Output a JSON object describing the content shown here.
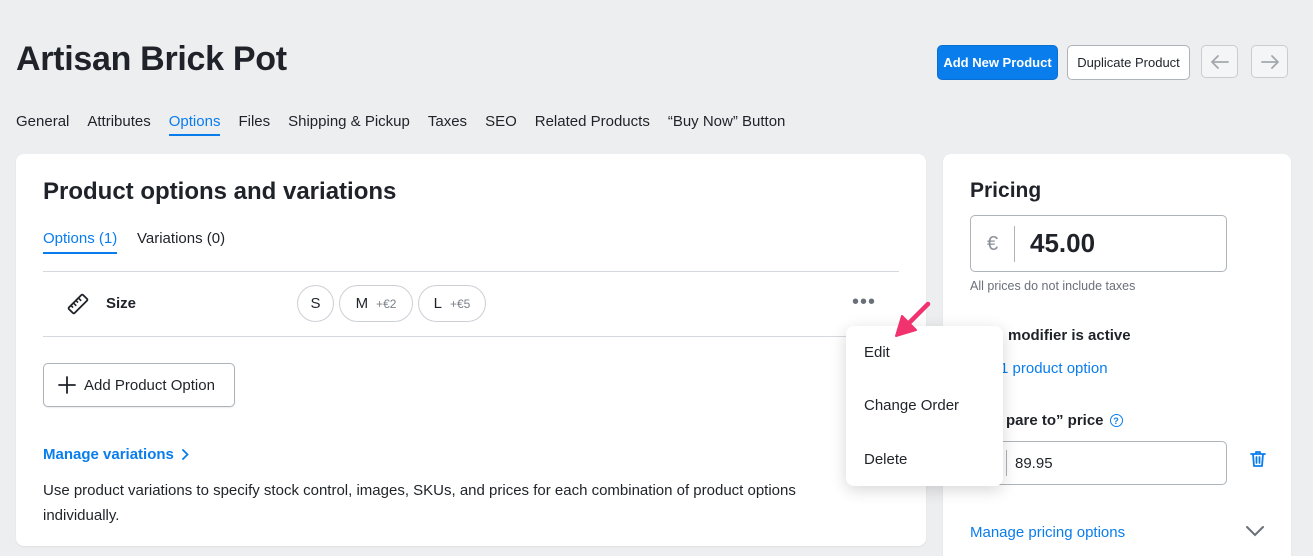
{
  "page": {
    "title": "Artisan Brick Pot"
  },
  "header": {
    "add_new_label": "Add New Product",
    "duplicate_label": "Duplicate Product",
    "prev_icon": "arrow-left-icon",
    "next_icon": "arrow-right-icon"
  },
  "tabs": [
    {
      "label": "General",
      "active": false
    },
    {
      "label": "Attributes",
      "active": false
    },
    {
      "label": "Options",
      "active": true
    },
    {
      "label": "Files",
      "active": false
    },
    {
      "label": "Shipping & Pickup",
      "active": false
    },
    {
      "label": "Taxes",
      "active": false
    },
    {
      "label": "SEO",
      "active": false
    },
    {
      "label": "Related Products",
      "active": false
    },
    {
      "label": "“Buy Now” Button",
      "active": false
    }
  ],
  "options_card": {
    "title": "Product options and variations",
    "subtabs": [
      {
        "label": "Options (1)",
        "active": true
      },
      {
        "label": "Variations (0)",
        "active": false
      }
    ],
    "option": {
      "icon": "ruler-icon",
      "name": "Size",
      "values": [
        {
          "label": "S",
          "modifier": ""
        },
        {
          "label": "M",
          "modifier": "+€2"
        },
        {
          "label": "L",
          "modifier": "+€5"
        }
      ]
    },
    "add_option_label": "Add Product Option",
    "manage_variations_label": "Manage variations",
    "description": "Use product variations to specify stock control, images, SKUs, and prices for each combination of product options individually."
  },
  "menu": {
    "items": [
      "Edit",
      "Change Order",
      "Delete"
    ]
  },
  "pricing": {
    "title": "Pricing",
    "currency": "€",
    "price": "45.00",
    "tax_note": "All prices do not include taxes",
    "modifier_text": "modifier is active",
    "option_link": "1 product option",
    "compare_label": "pare to” price",
    "compare_value": "89.95",
    "manage_label": "Manage pricing options"
  },
  "colors": {
    "accent": "#0a7ded",
    "annotation_arrow": "#f0336f",
    "background": "#edeef0"
  }
}
